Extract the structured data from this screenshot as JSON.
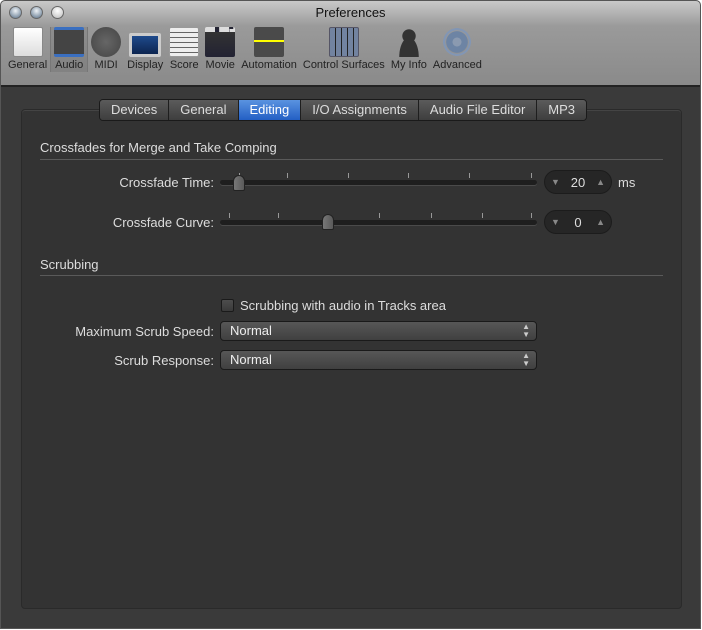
{
  "window": {
    "title": "Preferences"
  },
  "toolbar": [
    {
      "label": "General",
      "icon": "switch-icon",
      "selected": false
    },
    {
      "label": "Audio",
      "icon": "waveform-icon",
      "selected": true
    },
    {
      "label": "MIDI",
      "icon": "midi-connector-icon",
      "selected": false
    },
    {
      "label": "Display",
      "icon": "monitor-icon",
      "selected": false
    },
    {
      "label": "Score",
      "icon": "music-notes-icon",
      "selected": false
    },
    {
      "label": "Movie",
      "icon": "clapperboard-icon",
      "selected": false
    },
    {
      "label": "Automation",
      "icon": "automation-curve-icon",
      "selected": false
    },
    {
      "label": "Control Surfaces",
      "icon": "faders-icon",
      "selected": false
    },
    {
      "label": "My Info",
      "icon": "person-icon",
      "selected": false
    },
    {
      "label": "Advanced",
      "icon": "gear-icon",
      "selected": false
    }
  ],
  "tabs": [
    "Devices",
    "General",
    "Editing",
    "I/O Assignments",
    "Audio File Editor",
    "MP3"
  ],
  "active_tab": "Editing",
  "crossfades": {
    "heading": "Crossfades for Merge and Take Comping",
    "time_label": "Crossfade Time:",
    "time_value": "20",
    "time_unit": "ms",
    "curve_label": "Crossfade Curve:",
    "curve_value": "0"
  },
  "scrubbing": {
    "heading": "Scrubbing",
    "checkbox_label": "Scrubbing with audio in Tracks area",
    "checkbox_checked": false,
    "max_speed_label": "Maximum Scrub Speed:",
    "max_speed_value": "Normal",
    "response_label": "Scrub Response:",
    "response_value": "Normal"
  }
}
